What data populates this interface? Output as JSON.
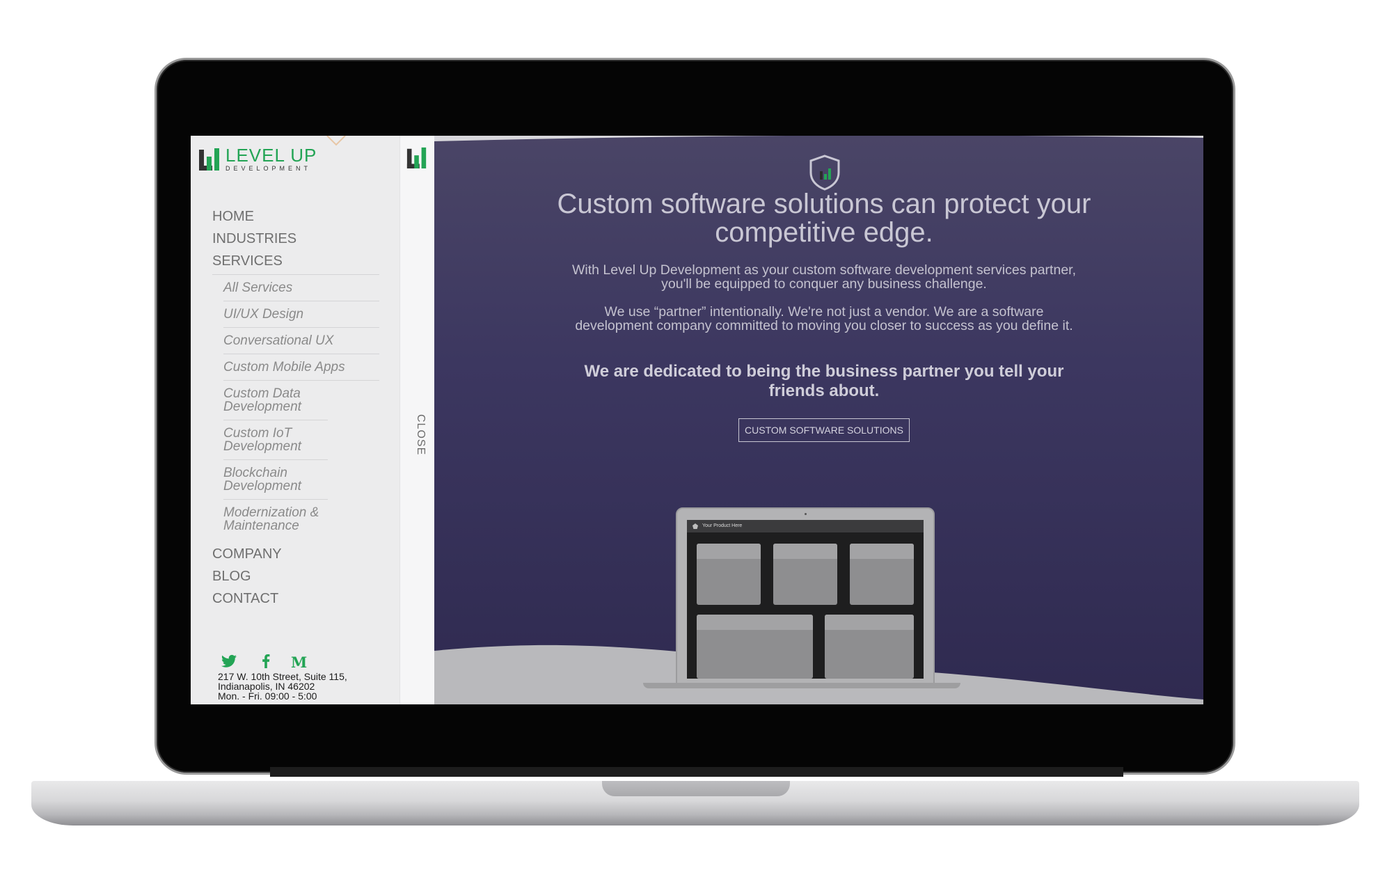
{
  "brand": {
    "name": "LEVEL UP",
    "subtitle": "DEVELOPMENT",
    "accent_color": "#23a455"
  },
  "nav": {
    "items": [
      {
        "label": "HOME"
      },
      {
        "label": "INDUSTRIES"
      },
      {
        "label": "SERVICES"
      }
    ],
    "services_sub": [
      {
        "label": "All Services"
      },
      {
        "label": "UI/UX Design"
      },
      {
        "label": "Conversational UX"
      },
      {
        "label": "Custom Mobile Apps"
      },
      {
        "label": "Custom Data Development"
      },
      {
        "label": "Custom IoT Development"
      },
      {
        "label": "Blockchain Development"
      },
      {
        "label": "Modernization & Maintenance"
      }
    ],
    "items_after": [
      {
        "label": "COMPANY"
      },
      {
        "label": "BLOG"
      },
      {
        "label": "CONTACT"
      }
    ]
  },
  "social": {
    "icons": [
      "twitter-icon",
      "facebook-icon",
      "medium-icon"
    ]
  },
  "address": {
    "line1": "217 W. 10th Street, Suite 115,",
    "line2": "Indianapolis, IN 46202",
    "hours": "Mon. - Fri. 09:00 - 5:00"
  },
  "close_strip": {
    "label": "CLOSE"
  },
  "hero": {
    "title": "Custom software solutions can protect your competitive edge.",
    "paragraph1": "With Level Up Development as your custom software development services partner, you'll be equipped to conquer any business challenge.",
    "paragraph2": "We use “partner” intentionally. We're not just a vendor. We are a software development company committed to moving you closer to success as you define it.",
    "strong": "We are dedicated to being the business partner you tell your friends about.",
    "cta": "CUSTOM SOFTWARE SOLUTIONS",
    "mock_app_title": "Your Product Here"
  }
}
